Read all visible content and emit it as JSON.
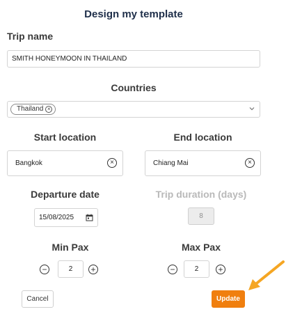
{
  "dialog": {
    "title": "Design my template"
  },
  "trip_name": {
    "label": "Trip name",
    "value": "SMITH HONEYMOON IN THAILAND"
  },
  "countries": {
    "label": "Countries",
    "selected": [
      {
        "label": "Thailand"
      }
    ]
  },
  "start_location": {
    "label": "Start location",
    "value": "Bangkok"
  },
  "end_location": {
    "label": "End location",
    "value": "Chiang Mai"
  },
  "departure_date": {
    "label": "Departure date",
    "value": "15/08/2025"
  },
  "trip_duration": {
    "label": "Trip duration (days)",
    "value": "8",
    "disabled": true
  },
  "min_pax": {
    "label": "Min Pax",
    "value": "2"
  },
  "max_pax": {
    "label": "Max Pax",
    "value": "2"
  },
  "actions": {
    "cancel_label": "Cancel",
    "update_label": "Update"
  },
  "colors": {
    "accent": "#f07f0f",
    "title": "#1f2f4a",
    "muted_label": "#b9b9b9",
    "disabled_bg": "#ececec"
  },
  "icons": {
    "chip_remove": "close-circle-icon",
    "dropdown": "chevron-down-icon",
    "clear": "close-circle-icon",
    "calendar": "calendar-icon",
    "decrement": "minus-circle-icon",
    "increment": "plus-circle-icon",
    "pointer": "arrow-icon"
  }
}
